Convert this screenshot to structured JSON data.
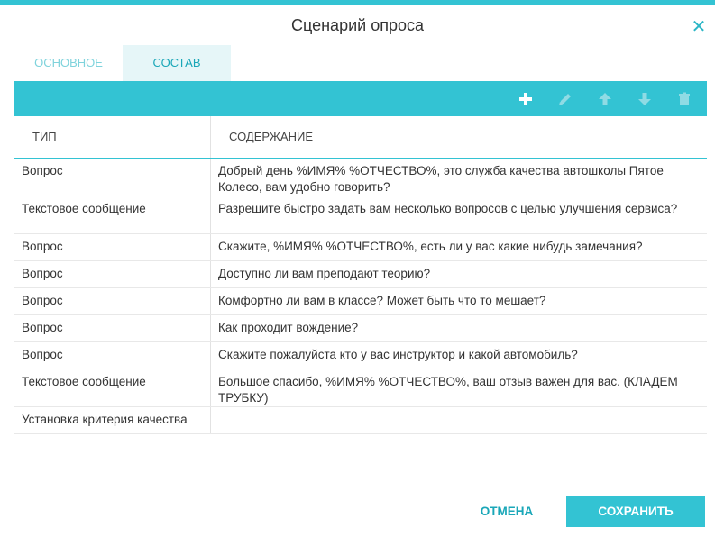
{
  "dialog": {
    "title": "Сценарий опроса",
    "close_icon": "close-icon"
  },
  "tabs": [
    {
      "label": "Основное",
      "active": false
    },
    {
      "label": "Состав",
      "active": true
    }
  ],
  "toolbar": {
    "buttons": [
      {
        "icon": "plus-icon",
        "enabled": true
      },
      {
        "icon": "pencil-icon",
        "enabled": false
      },
      {
        "icon": "arrow-up-icon",
        "enabled": false
      },
      {
        "icon": "arrow-down-icon",
        "enabled": false
      },
      {
        "icon": "trash-icon",
        "enabled": false
      }
    ]
  },
  "table": {
    "headers": {
      "type": "Тип",
      "content": "Содержание"
    },
    "rows": [
      {
        "type": "Вопрос",
        "content": "Добрый день %ИМЯ% %ОТЧЕСТВО%, это служба качества автошколы Пятое Колесо, вам удобно говорить?"
      },
      {
        "type": "Текстовое сообщение",
        "content": "Разрешите быстро задать вам несколько вопросов с целью улучшения сервиса?"
      },
      {
        "type": "Вопрос",
        "content": "Скажите, %ИМЯ% %ОТЧЕСТВО%, есть ли у вас какие нибудь замечания?"
      },
      {
        "type": "Вопрос",
        "content": "Доступно ли вам преподают теорию?"
      },
      {
        "type": "Вопрос",
        "content": "Комфортно ли вам в классе? Может быть что то мешает?"
      },
      {
        "type": "Вопрос",
        "content": "Как проходит вождение?"
      },
      {
        "type": "Вопрос",
        "content": "Скажите пожалуйста кто у вас инструктор и какой автомобиль?"
      },
      {
        "type": "Текстовое сообщение",
        "content": "Большое спасибо, %ИМЯ% %ОТЧЕСТВО%, ваш отзыв важен для вас. (КЛАДЕМ ТРУБКУ)"
      },
      {
        "type": "Установка критерия качества",
        "content": ""
      }
    ]
  },
  "footer": {
    "cancel_label": "Отмена",
    "save_label": "Сохранить"
  },
  "colors": {
    "accent": "#33c3d3",
    "accent_dark": "#1aa7b8",
    "tab_active_bg": "#e6f6f8",
    "icon_disabled": "#8fdbe4"
  }
}
